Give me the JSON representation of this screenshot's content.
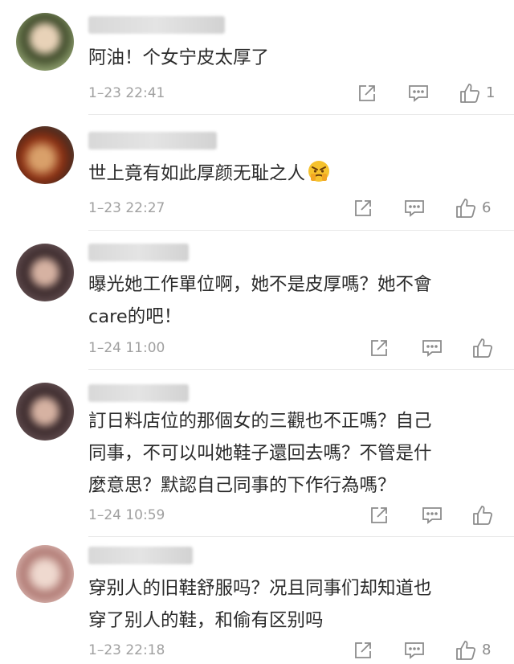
{
  "comments": [
    {
      "text": "阿油！个女宁皮太厚了",
      "timestamp": "1–23 22:41",
      "like_count": "1",
      "avatar_color": "#6f7a5a",
      "emoji": ""
    },
    {
      "text": "世上竟有如此厚颜无耻之人",
      "timestamp": "1–23 22:27",
      "like_count": "6",
      "avatar_color": "#b0562c",
      "emoji": "angry-emoji"
    },
    {
      "text": "曝光她工作單位啊，她不是皮厚嗎？她不會\ncare的吧！",
      "timestamp": "1–24 11:00",
      "like_count": "",
      "avatar_color": "#3a2f33",
      "emoji": ""
    },
    {
      "text": "訂日料店位的那個女的三觀也不正嗎？自己\n同事，不可以叫她鞋子還回去嗎？不管是什\n麼意思？默認自己同事的下作行為嗎？",
      "timestamp": "1–24 10:59",
      "like_count": "",
      "avatar_color": "#3a2f33",
      "emoji": ""
    },
    {
      "text": "穿别人的旧鞋舒服吗？况且同事们却知道也\n穿了别人的鞋，和偷有区别吗",
      "timestamp": "1–23 22:18",
      "like_count": "8",
      "avatar_color": "#b58a86",
      "emoji": ""
    }
  ],
  "icons": {
    "share": "share-icon",
    "reply": "reply-icon",
    "like": "thumbs-up-icon"
  }
}
